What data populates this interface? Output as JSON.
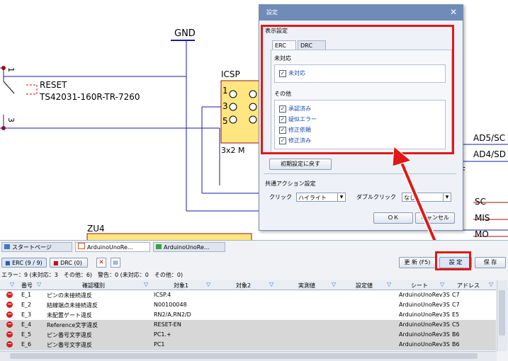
{
  "schematic": {
    "gnd": "GND",
    "pin1": "1",
    "pin3": "3",
    "reset_name": "RESET",
    "reset_part": "TS42031-160R-TR-7260",
    "icsp": "ICSP",
    "icsp_pins": [
      "1",
      "3",
      "5"
    ],
    "icsp_size": "3x2 M",
    "zu4": "ZU4",
    "f_label": "F",
    "right_labels": [
      "AD5/SC",
      "AD4/SD",
      "SC",
      "MIS",
      "MO"
    ]
  },
  "dialog": {
    "title": "設定",
    "section_display": "表示設定",
    "tabs": [
      "ERC",
      "DRC"
    ],
    "group_unhandled": "未対応",
    "check_unhandled": "未対応",
    "group_other": "その他",
    "checks_other": [
      "承認済み",
      "疑似エラー",
      "修正依頼",
      "修正済み"
    ],
    "reset_button": "初期設定に戻す",
    "section_action": "共通アクション設定",
    "click_label": "クリック",
    "click_value": "ハイライト",
    "dblclick_label": "ダブルクリック",
    "dblclick_value": "なし",
    "ok": "ＯＫ",
    "cancel": "キャンセル"
  },
  "panel": {
    "doc_tabs": [
      "スタートページ",
      "ArduinoUnoRe...",
      "ArduinoUnoRe..."
    ],
    "erc_tab": "ERC (9 / 9)",
    "drc_tab": "DRC (0)",
    "update_button": "更 新 (F5)",
    "settings_button": "設 定",
    "save_button": "保 存",
    "summary": "エラー：9 (未対応：3　その他：6)　警告：0 (未対応：0　その他：0)",
    "columns": [
      "番号",
      "確認種別",
      "対象1",
      "対象2",
      "実測値",
      "設定値",
      "シート",
      "アドレス"
    ],
    "rows": [
      {
        "no": "E_1",
        "type": "ピンの未接続違反",
        "target1": "ICSP.4",
        "sheet": "ArduinoUnoRev3S",
        "addr": "C7"
      },
      {
        "no": "E_2",
        "type": "結線端点未接続違反",
        "target1": "N00100048",
        "sheet": "ArduinoUnoRev3S",
        "addr": "C7"
      },
      {
        "no": "E_3",
        "type": "未配置ゲート違反",
        "target1": "RN2/A,RN2/D",
        "sheet": "ArduinoUnoRev3S",
        "addr": "E5"
      },
      {
        "no": "E_4",
        "type": "Reference文字違反",
        "target1": "RESET-EN",
        "sheet": "ArduinoUnoRev3S",
        "addr": "C5"
      },
      {
        "no": "E_5",
        "type": "ピン番号文字違反",
        "target1": "PC1.+",
        "sheet": "ArduinoUnoRev3S",
        "addr": "B6"
      },
      {
        "no": "E_6",
        "type": "ピン番号文字違反",
        "target1": "PC1",
        "sheet": "ArduinoUnoRev3S",
        "addr": "B6"
      }
    ]
  },
  "colors": {
    "highlight_red": "#e01818",
    "wire_blue": "#1a1aa8",
    "titlebar": "#6f8cb8",
    "icsp_fill": "#ffe680"
  }
}
